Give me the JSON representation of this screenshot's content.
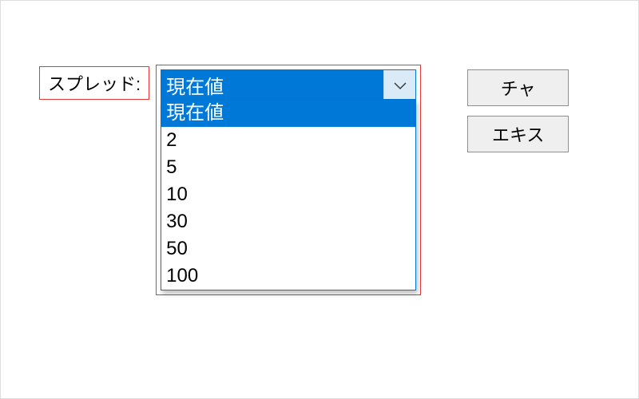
{
  "spread": {
    "label": "スプレッド:",
    "selected": "現在値",
    "options": [
      "現在値",
      "2",
      "5",
      "10",
      "30",
      "50",
      "100"
    ]
  },
  "buttons": {
    "chart": "チャ",
    "expert": "エキス"
  }
}
